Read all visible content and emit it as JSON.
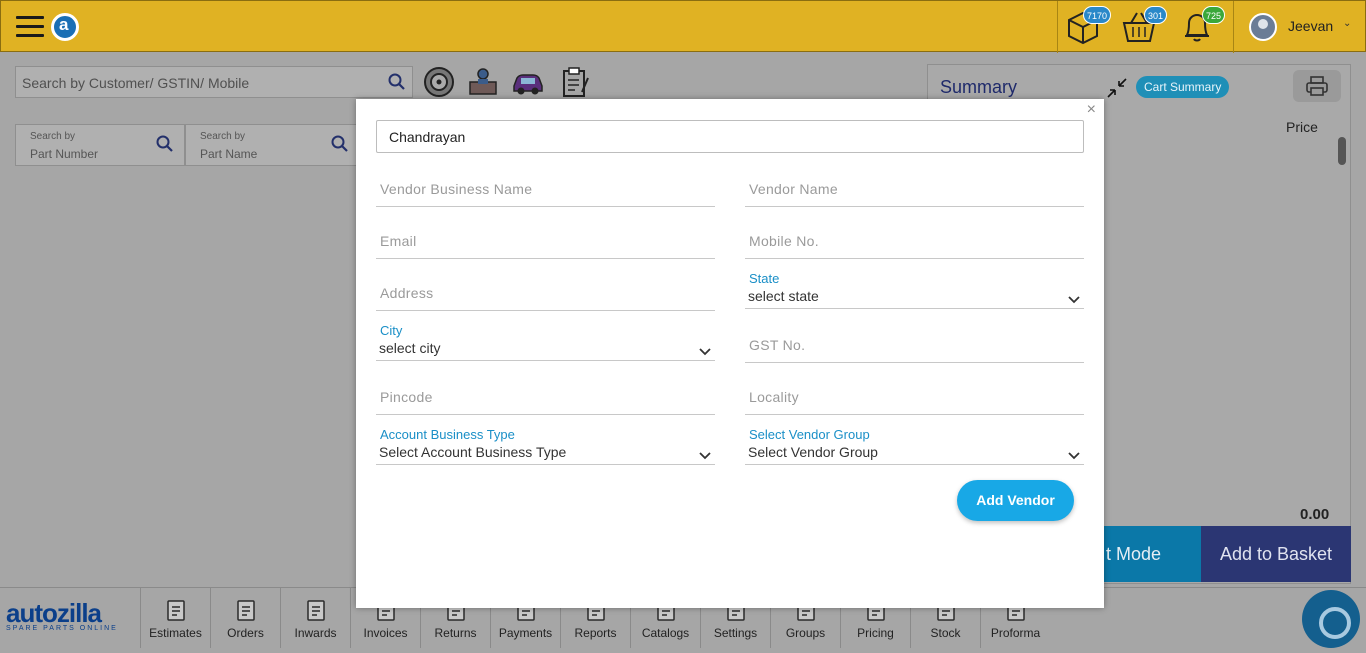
{
  "header": {
    "badges": {
      "box": "7170",
      "basket": "301",
      "bell": "725"
    },
    "user": {
      "name": "Jeevan"
    },
    "colors": {
      "bar": "#e0b223",
      "badge_blue": "#2a88c9",
      "badge_green": "#3aa83a"
    }
  },
  "main": {
    "search_placeholder": "Search by Customer/ GSTIN/ Mobile",
    "part_number": {
      "label": "Search by",
      "value": "Part Number"
    },
    "part_name": {
      "label": "Search by",
      "value": "Part Name"
    },
    "tool_icons": [
      "tyre-icon",
      "mechanic-icon",
      "car-icon",
      "clipboard-icon"
    ]
  },
  "summary": {
    "title": "Summary",
    "cart_summary": "Cart Summary",
    "price_label": "Price",
    "total": "0.00",
    "mode_button": "t Mode",
    "add_basket": "Add to Basket"
  },
  "bottom_nav": {
    "brand": "autozilla",
    "brand_sub": "SPARE PARTS ONLINE",
    "items": [
      {
        "label": "Estimates",
        "icon": "estimate-icon"
      },
      {
        "label": "Orders",
        "icon": "orders-icon"
      },
      {
        "label": "Inwards",
        "icon": "inwards-icon"
      },
      {
        "label": "Invoices",
        "icon": "invoice-icon"
      },
      {
        "label": "Returns",
        "icon": "returns-icon"
      },
      {
        "label": "Payments",
        "icon": "payments-icon"
      },
      {
        "label": "Reports",
        "icon": "reports-icon"
      },
      {
        "label": "Catalogs",
        "icon": "catalogs-icon"
      },
      {
        "label": "Settings",
        "icon": "settings-icon"
      },
      {
        "label": "Groups",
        "icon": "groups-icon"
      },
      {
        "label": "Pricing",
        "icon": "pricing-icon"
      },
      {
        "label": "Stock",
        "icon": "stock-icon"
      },
      {
        "label": "Proforma",
        "icon": "proforma-icon"
      }
    ]
  },
  "modal": {
    "close": "×",
    "search_value": "Chandrayan",
    "vendor_business_name": "Vendor Business Name",
    "vendor_name": "Vendor Name",
    "email": "Email",
    "mobile": "Mobile No.",
    "address": "Address",
    "state": {
      "label": "State",
      "value": "select state"
    },
    "city": {
      "label": "City",
      "value": "select city"
    },
    "gst": "GST No.",
    "pincode": "Pincode",
    "locality": "Locality",
    "account_business_type": {
      "label": "Account Business Type",
      "value": "Select Account Business Type"
    },
    "vendor_group": {
      "label": "Select Vendor Group",
      "value": "Select Vendor Group"
    },
    "add_vendor": "Add Vendor"
  }
}
